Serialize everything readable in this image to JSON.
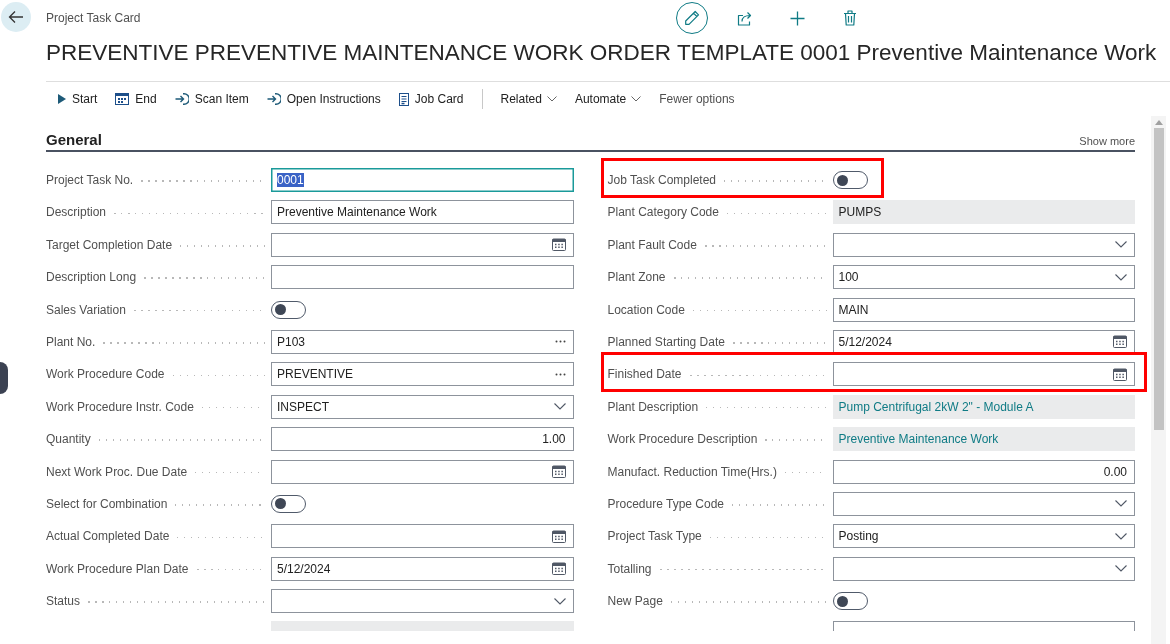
{
  "page": {
    "caption": "Project Task Card",
    "title": "PREVENTIVE PREVENTIVE MAINTENANCE WORK ORDER TEMPLATE 0001 Preventive Maintenance Work"
  },
  "header_actions": [
    {
      "kind": "edit",
      "on": true
    },
    {
      "kind": "share",
      "on": false
    },
    {
      "kind": "new",
      "on": false
    },
    {
      "kind": "delete",
      "on": false
    }
  ],
  "actions": [
    {
      "kind": "start",
      "label": "Start"
    },
    {
      "kind": "end",
      "label": "End"
    },
    {
      "kind": "scan",
      "label": "Scan Item"
    },
    {
      "kind": "instructions",
      "label": "Open Instructions"
    },
    {
      "kind": "card",
      "label": "Job Card"
    },
    {
      "kind": "menu",
      "label": "Related"
    },
    {
      "kind": "menu",
      "label": "Automate"
    },
    {
      "kind": "less",
      "label": "Fewer options"
    }
  ],
  "general": {
    "title": "General",
    "show_more": "Show more",
    "left_fields": [
      {
        "label": "Project Task No.",
        "kind": "text",
        "value": "0001",
        "focused": true,
        "highlighted": false
      },
      {
        "label": "Description",
        "kind": "text",
        "value": "Preventive Maintenance Work",
        "focused": false,
        "highlighted": false
      },
      {
        "label": "Target Completion Date",
        "kind": "date",
        "focused": false,
        "highlighted": false
      },
      {
        "label": "Description Long",
        "kind": "text",
        "focused": false,
        "highlighted": false
      },
      {
        "label": "Sales Variation",
        "kind": "toggle",
        "on": false,
        "focused": false,
        "highlighted": false
      },
      {
        "label": "Plant No.",
        "kind": "lookup",
        "value": "P103",
        "focused": false,
        "highlighted": false
      },
      {
        "label": "Work Procedure Code",
        "kind": "lookup",
        "value": "PREVENTIVE",
        "focused": false,
        "highlighted": false
      },
      {
        "label": "Work Procedure Instr. Code",
        "kind": "dropdown",
        "value": "INSPECT",
        "focused": false,
        "highlighted": false
      },
      {
        "label": "Quantity",
        "kind": "number",
        "value": "1.00",
        "focused": false,
        "highlighted": false
      },
      {
        "label": "Next Work Proc. Due Date",
        "kind": "date",
        "focused": false,
        "highlighted": false
      },
      {
        "label": "Select for Combination",
        "kind": "toggle",
        "on": false,
        "focused": false,
        "highlighted": false
      },
      {
        "label": "Actual Completed Date",
        "kind": "date",
        "focused": false,
        "highlighted": false
      },
      {
        "label": "Work Procedure Plan Date",
        "kind": "date",
        "value": "5/12/2024",
        "focused": false,
        "highlighted": false
      },
      {
        "label": "Status",
        "kind": "dropdown",
        "focused": false,
        "highlighted": false
      }
    ],
    "left_partial_field": {
      "kind": "readonly"
    },
    "right_fields": [
      {
        "label": "Job Task Completed",
        "kind": "toggle",
        "on": false,
        "focused": false,
        "highlighted": true
      },
      {
        "label": "Plant Category Code",
        "kind": "readonly",
        "value": "PUMPS",
        "focused": false,
        "highlighted": false
      },
      {
        "label": "Plant Fault Code",
        "kind": "dropdown",
        "focused": false,
        "highlighted": false
      },
      {
        "label": "Plant Zone",
        "kind": "dropdown",
        "value": "100",
        "focused": false,
        "highlighted": false
      },
      {
        "label": "Location Code",
        "kind": "text",
        "value": "MAIN",
        "focused": false,
        "highlighted": false
      },
      {
        "label": "Planned Starting Date",
        "kind": "date",
        "value": "5/12/2024",
        "focused": false,
        "highlighted": false
      },
      {
        "label": "Finished Date",
        "kind": "date",
        "focused": false,
        "highlighted": true
      },
      {
        "label": "Plant Description",
        "kind": "readonly_link",
        "value": "Pump Centrifugal 2kW 2\" - Module A",
        "focused": false,
        "highlighted": false
      },
      {
        "label": "Work Procedure Description",
        "kind": "readonly_link",
        "value": "Preventive Maintenance Work",
        "focused": false,
        "highlighted": false
      },
      {
        "label": "Manufact. Reduction Time(Hrs.)",
        "kind": "number",
        "value": "0.00",
        "focused": false,
        "highlighted": false
      },
      {
        "label": "Procedure Type Code",
        "kind": "dropdown",
        "focused": false,
        "highlighted": false
      },
      {
        "label": "Project Task Type",
        "kind": "dropdown",
        "value": "Posting",
        "focused": false,
        "highlighted": false
      },
      {
        "label": "Totalling",
        "kind": "dropdown",
        "focused": false,
        "highlighted": false
      },
      {
        "label": "New Page",
        "kind": "toggle",
        "on": false,
        "focused": false,
        "highlighted": false
      }
    ],
    "right_partial_field": {
      "kind": "text"
    }
  }
}
